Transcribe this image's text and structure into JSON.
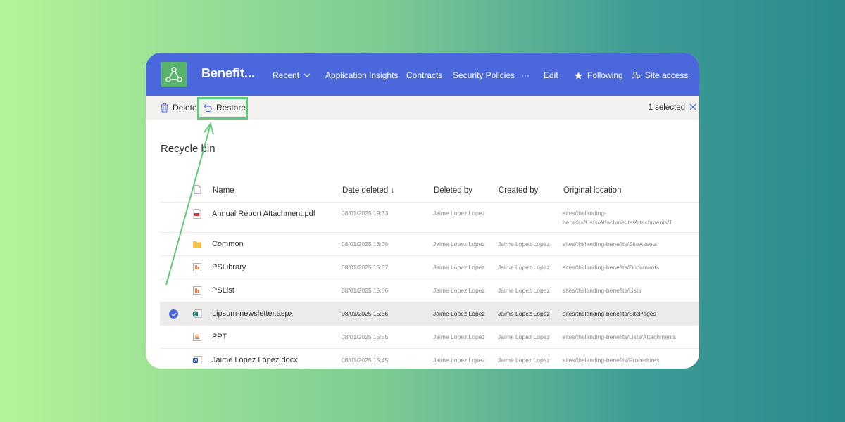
{
  "site": {
    "title": "Benefit...",
    "nav": [
      "Recent",
      "Application Insights",
      "Contracts",
      "Security Policies",
      "···",
      "Edit"
    ],
    "following_label": "Following",
    "site_access_label": "Site access"
  },
  "commandbar": {
    "delete_label": "Delete",
    "restore_label": "Restore",
    "selected_text": "1 selected"
  },
  "page": {
    "title": "Recycle bin"
  },
  "table": {
    "columns": [
      "Name",
      "Date deleted ↓",
      "Deleted by",
      "Created by",
      "Original location"
    ],
    "rows": [
      {
        "icon": "pdf-file-icon",
        "name": "Annual Report Attachment.pdf",
        "date": "08/01/2025 19:33",
        "deleted_by": "Jaime Lopez Lopez",
        "created_by": "",
        "location1": "sites/thelanding-",
        "location2": "benefits/Lists/Attachments/Attachments/1"
      },
      {
        "icon": "folder-icon",
        "name": "Common",
        "date": "08/01/2025 16:08",
        "deleted_by": "Jaime Lopez Lopez",
        "created_by": "Jaime Lopez Lopez",
        "location1": "sites/thelanding-benefits/SiteAssets",
        "location2": ""
      },
      {
        "icon": "library-icon",
        "name": "PSLibrary",
        "date": "08/01/2025 15:57",
        "deleted_by": "Jaime Lopez Lopez",
        "created_by": "Jaime Lopez Lopez",
        "location1": "sites/thelanding-benefits/Documents",
        "location2": ""
      },
      {
        "icon": "list-icon",
        "name": "PSList",
        "date": "08/01/2025 15:56",
        "deleted_by": "Jaime Lopez Lopez",
        "created_by": "Jaime Lopez Lopez",
        "location1": "sites/thelanding-benefits/Lists",
        "location2": ""
      },
      {
        "icon": "sharepoint-page-icon",
        "name": "Lipsum-newsletter.aspx",
        "date": "08/01/2025 15:56",
        "deleted_by": "Jaime Lopez Lopez",
        "created_by": "Jaime Lopez Lopez",
        "location1": "sites/thelanding-benefits/SitePages",
        "location2": "",
        "selected": true
      },
      {
        "icon": "list-icon",
        "name": "PPT",
        "date": "08/01/2025 15:55",
        "deleted_by": "Jaime Lopez Lopez",
        "created_by": "Jaime Lopez Lopez",
        "location1": "sites/thelanding-benefits/Lists/Attachments",
        "location2": ""
      },
      {
        "icon": "word-doc-icon",
        "name": "Jaime López López.docx",
        "date": "08/01/2025 15:45",
        "deleted_by": "Jaime Lopez Lopez",
        "created_by": "Jaime Lopez Lopez",
        "location1": "sites/thelanding-benefits/Procedures",
        "location2": ""
      }
    ]
  },
  "colors": {
    "brand": "#4a68dc",
    "highlight": "#5fca7a",
    "selected_row": "#edebe9"
  }
}
